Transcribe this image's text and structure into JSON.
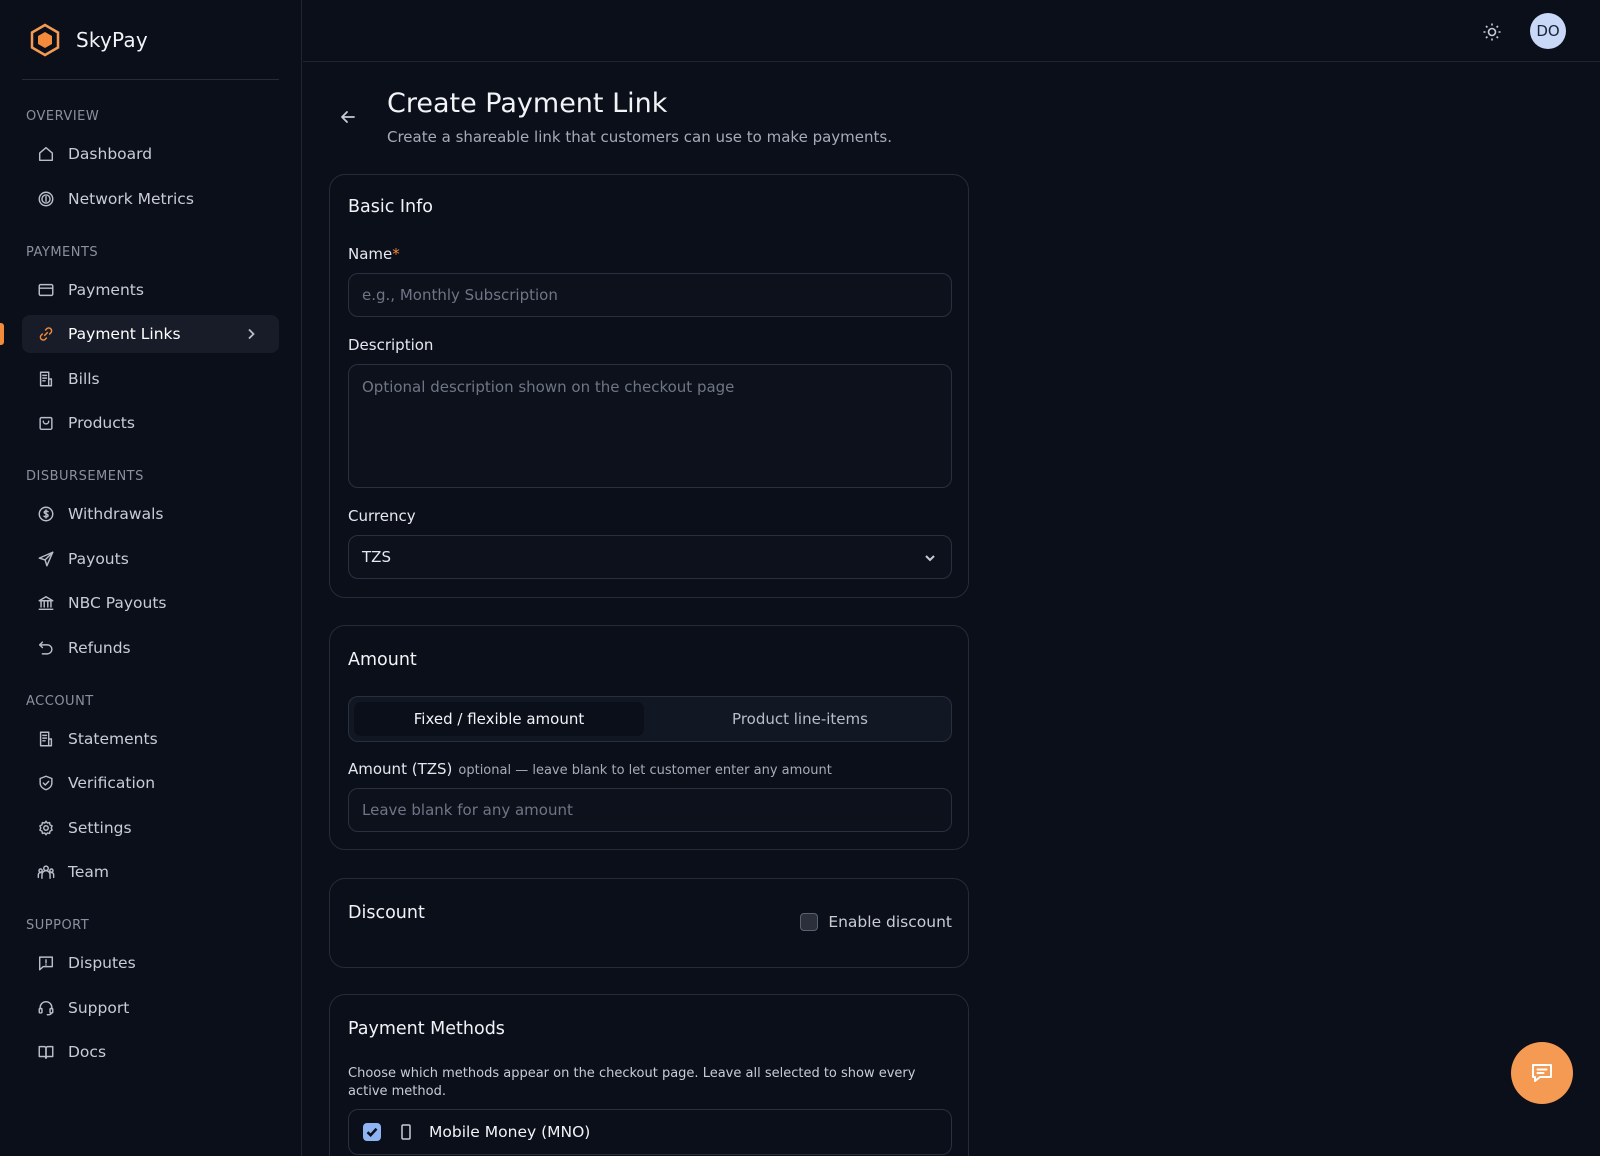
{
  "app": {
    "name": "SkyPay",
    "logo_icon": "hexagon-logo-icon",
    "accent_color": "#f28b3c"
  },
  "sidebar": {
    "sections": [
      {
        "title": "OVERVIEW",
        "items": [
          {
            "label": "Dashboard",
            "icon": "home-icon"
          },
          {
            "label": "Network Metrics",
            "icon": "network-coin-icon"
          }
        ]
      },
      {
        "title": "PAYMENTS",
        "items": [
          {
            "label": "Payments",
            "icon": "card-icon"
          },
          {
            "label": "Payment Links",
            "icon": "link-icon",
            "active": true
          },
          {
            "label": "Bills",
            "icon": "receipt-icon"
          },
          {
            "label": "Products",
            "icon": "bag-icon"
          }
        ]
      },
      {
        "title": "DISBURSEMENTS",
        "items": [
          {
            "label": "Withdrawals",
            "icon": "dollar-circle-icon"
          },
          {
            "label": "Payouts",
            "icon": "send-icon"
          },
          {
            "label": "NBC Payouts",
            "icon": "bank-icon"
          },
          {
            "label": "Refunds",
            "icon": "undo-icon"
          }
        ]
      },
      {
        "title": "ACCOUNT",
        "items": [
          {
            "label": "Statements",
            "icon": "document-icon"
          },
          {
            "label": "Verification",
            "icon": "shield-check-icon"
          },
          {
            "label": "Settings",
            "icon": "gear-icon"
          },
          {
            "label": "Team",
            "icon": "team-icon"
          }
        ]
      },
      {
        "title": "SUPPORT",
        "items": [
          {
            "label": "Disputes",
            "icon": "alert-message-icon"
          },
          {
            "label": "Support",
            "icon": "headset-icon"
          },
          {
            "label": "Docs",
            "icon": "book-icon"
          }
        ]
      }
    ]
  },
  "topbar": {
    "theme_icon": "sun-icon",
    "avatar_initials": "DO"
  },
  "page": {
    "title": "Create Payment Link",
    "subtitle": "Create a shareable link that customers can use to make payments."
  },
  "basic_info": {
    "title": "Basic Info",
    "name_label": "Name",
    "name_required": "*",
    "name_placeholder": "e.g., Monthly Subscription",
    "name_value": "",
    "description_label": "Description",
    "description_placeholder": "Optional description shown on the checkout page",
    "description_value": "",
    "currency_label": "Currency",
    "currency_value": "TZS"
  },
  "amount": {
    "title": "Amount",
    "tabs": [
      "Fixed / flexible amount",
      "Product line-items"
    ],
    "selected_tab": "Fixed / flexible amount",
    "amount_label": "Amount (TZS)",
    "amount_hint": "optional — leave blank to let customer enter any amount",
    "amount_placeholder": "Leave blank for any amount",
    "amount_value": ""
  },
  "discount": {
    "title": "Discount",
    "toggle_label": "Enable discount",
    "enabled": false
  },
  "payment_methods": {
    "title": "Payment Methods",
    "help": "Choose which methods appear on the checkout page. Leave all selected to show every active method.",
    "methods": [
      {
        "label": "Mobile Money (MNO)",
        "icon": "phone-icon",
        "checked": true
      }
    ]
  },
  "chat_fab": {
    "icon": "chat-icon"
  }
}
